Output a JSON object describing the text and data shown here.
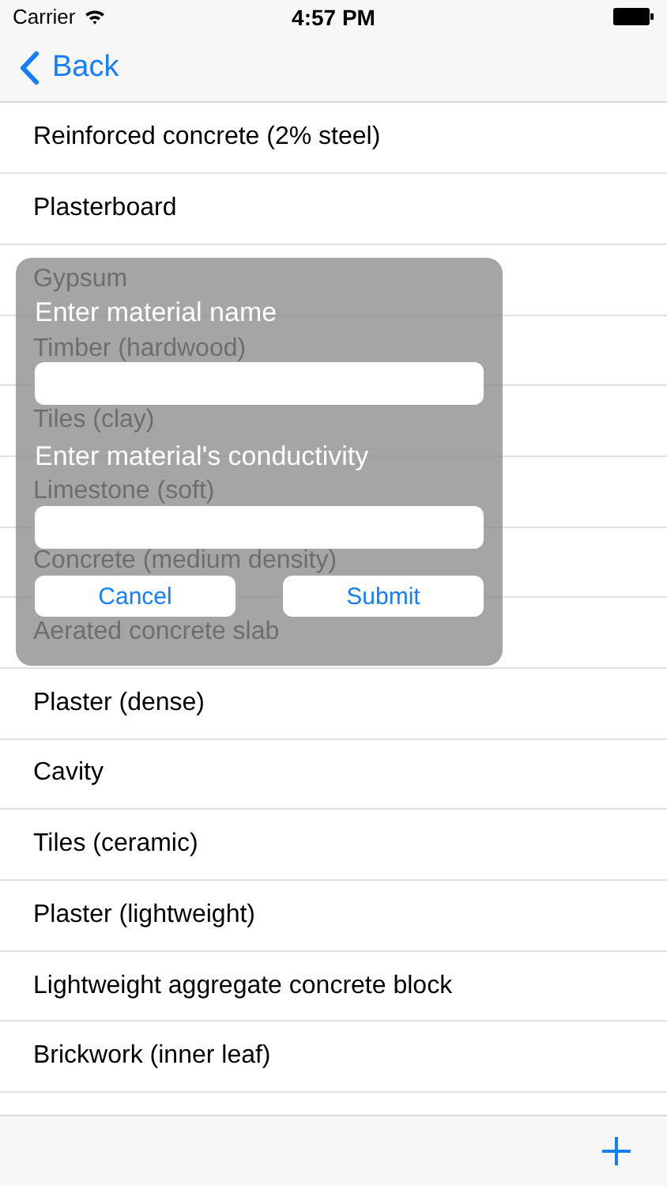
{
  "status_bar": {
    "carrier": "Carrier",
    "time": "4:57 PM"
  },
  "nav_bar": {
    "back_label": "Back"
  },
  "materials": [
    {
      "name": "Reinforced concrete (2% steel)"
    },
    {
      "name": "Plasterboard"
    },
    {
      "name": "Gypsum"
    },
    {
      "name": "Timber (hardwood)"
    },
    {
      "name": "Tiles (clay)"
    },
    {
      "name": "Limestone (soft)"
    },
    {
      "name": "Concrete (medium density)"
    },
    {
      "name": "Aerated concrete slab"
    },
    {
      "name": "Plaster (dense)"
    },
    {
      "name": "Cavity"
    },
    {
      "name": "Tiles (ceramic)"
    },
    {
      "name": "Plaster (lightweight)"
    },
    {
      "name": "Lightweight aggregate concrete block"
    },
    {
      "name": "Brickwork (inner leaf)"
    }
  ],
  "dialog": {
    "fields": [
      {
        "label": "Enter material name"
      },
      {
        "label": "Enter material's conductivity"
      }
    ],
    "buttons": [
      "Cancel",
      "Submit"
    ]
  }
}
